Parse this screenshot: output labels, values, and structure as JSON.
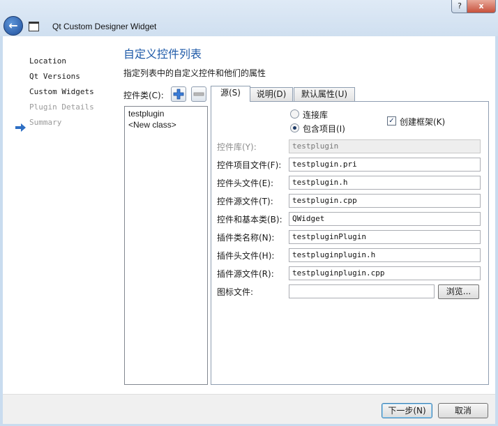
{
  "window": {
    "title": "Qt Custom Designer Widget",
    "help_label": "?",
    "close_label": "x"
  },
  "steps": [
    {
      "label": "Location",
      "state": "done"
    },
    {
      "label": "Qt Versions",
      "state": "done"
    },
    {
      "label": "Custom Widgets",
      "state": "current"
    },
    {
      "label": "Plugin Details",
      "state": "pending"
    },
    {
      "label": "Summary",
      "state": "pending"
    }
  ],
  "page": {
    "title": "自定义控件列表",
    "subtitle": "指定列表中的自定义控件和他们的属性"
  },
  "widget_list": {
    "label": "控件类(C):",
    "items": [
      "testplugin",
      "<New class>"
    ]
  },
  "tabs": [
    "源(S)",
    "说明(D)",
    "默认属性(U)"
  ],
  "source_tab": {
    "link_library_label": "连接库",
    "include_project_label": "包含项目(I)",
    "create_skeleton_label": "创建框架(K)",
    "include_project_selected": true,
    "create_skeleton_checked": true,
    "fields": [
      {
        "label": "控件库(Y):",
        "value": "testplugin",
        "disabled": true
      },
      {
        "label": "控件项目文件(F):",
        "value": "testplugin.pri"
      },
      {
        "label": "控件头文件(E):",
        "value": "testplugin.h"
      },
      {
        "label": "控件源文件(T):",
        "value": "testplugin.cpp"
      },
      {
        "label": "控件和基本类(B):",
        "value": "QWidget"
      },
      {
        "label": "插件类名称(N):",
        "value": "testpluginPlugin"
      },
      {
        "label": "插件头文件(H):",
        "value": "testpluginplugin.h"
      },
      {
        "label": "插件源文件(R):",
        "value": "testpluginplugin.cpp"
      },
      {
        "label": "图标文件:",
        "value": ""
      }
    ],
    "browse_label": "浏览..."
  },
  "footer": {
    "next_label": "下一步(N)",
    "cancel_label": "取消"
  },
  "colors": {
    "title_blue": "#1e5aa8",
    "frame": "#c9dcef",
    "step_arrow": "#2e6fc4"
  }
}
